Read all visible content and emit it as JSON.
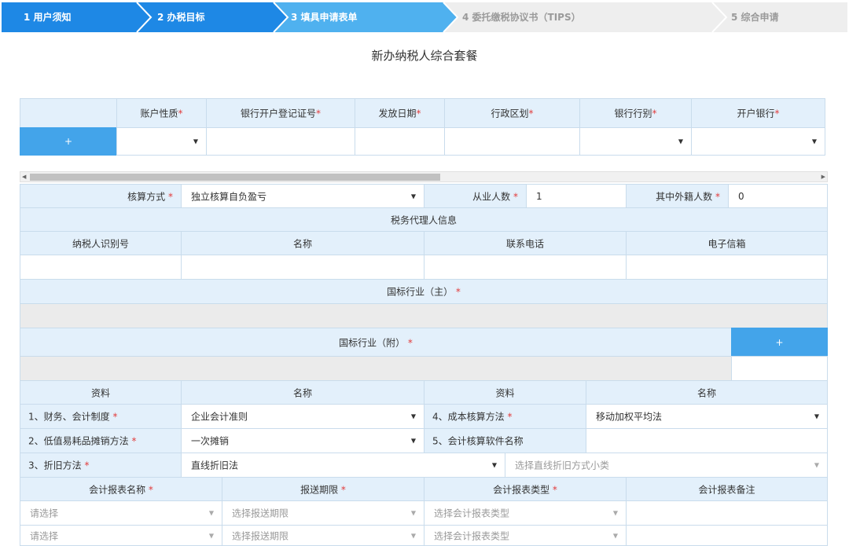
{
  "steps": [
    {
      "label": "1 用户须知",
      "state": "done"
    },
    {
      "label": "2 办税目标",
      "state": "done"
    },
    {
      "label": "3 填具申请表单",
      "state": "active"
    },
    {
      "label": "4 委托缴税协议书（TIPS）",
      "state": "todo"
    },
    {
      "label": "5 综合申请",
      "state": "todo"
    }
  ],
  "title": "新办纳税人综合套餐",
  "bank_table": {
    "headers": [
      "账户性质",
      "银行开户登记证号",
      "发放日期",
      "行政区划",
      "银行行别",
      "开户银行"
    ],
    "add_label": "+"
  },
  "accounting": {
    "method_label": "核算方式",
    "method_value": "独立核算自负盈亏",
    "employees_label": "从业人数",
    "employees_value": "1",
    "foreign_label": "其中外籍人数",
    "foreign_value": "0"
  },
  "agent": {
    "section_title": "税务代理人信息",
    "headers": [
      "纳税人识别号",
      "名称",
      "联系电话",
      "电子信箱"
    ]
  },
  "industry": {
    "main_label": "国标行业（主）",
    "sub_label": "国标行业（附）",
    "add_label": "+"
  },
  "materials": {
    "headers": [
      "资料",
      "名称",
      "资料",
      "名称"
    ],
    "rows": [
      {
        "left_label": "1、财务、会计制度",
        "left_value": "企业会计准则",
        "right_label": "4、成本核算方法",
        "right_value": "移动加权平均法"
      },
      {
        "left_label": "2、低值易耗品摊销方法",
        "left_value": "一次摊销",
        "right_label": "5、会计核算软件名称",
        "right_value": ""
      }
    ],
    "depreciation_label": "3、折旧方法",
    "depreciation_value": "直线折旧法",
    "depreciation_sub_placeholder": "选择直线折旧方式小类"
  },
  "reports": {
    "headers": [
      "会计报表名称",
      "报送期限",
      "会计报表类型",
      "会计报表备注"
    ],
    "rows": [
      {
        "name": "请选择",
        "period": "选择报送期限",
        "type": "选择会计报表类型"
      },
      {
        "name": "请选择",
        "period": "选择报送期限",
        "type": "选择会计报表类型"
      }
    ]
  },
  "required_mark": "*",
  "colors": {
    "step_done": "#1e88e5",
    "step_active": "#4fb1ef",
    "step_todo": "#eeeeee",
    "header_bg": "#e3f0fb",
    "required": "#e23a3a",
    "button": "#43a4ea"
  }
}
